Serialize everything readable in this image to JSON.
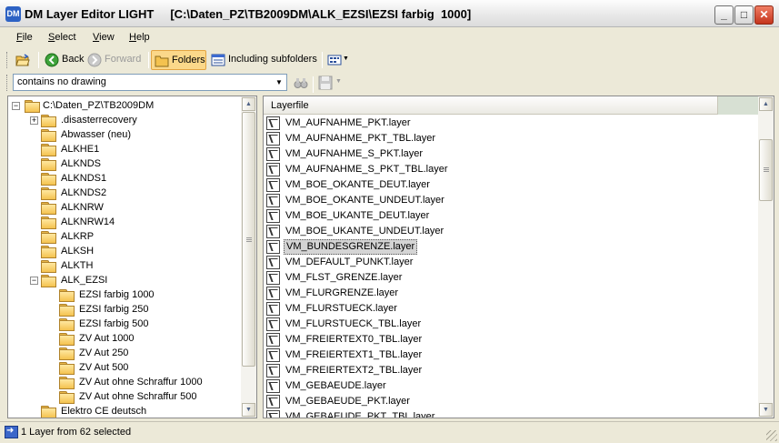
{
  "window": {
    "app_icon_text": "DM",
    "title": "DM Layer Editor LIGHT     [C:\\Daten_PZ\\TB2009DM\\ALK_EZSI\\EZSI farbig  1000]",
    "minimize": "_",
    "maximize": "□",
    "close": "✕"
  },
  "menu": [
    {
      "accel": "F",
      "rest": "ile"
    },
    {
      "accel": "S",
      "rest": "elect"
    },
    {
      "accel": "V",
      "rest": "iew"
    },
    {
      "accel": "H",
      "rest": "elp"
    }
  ],
  "toolbar": {
    "back": "Back",
    "forward": "Forward",
    "folders": "Folders",
    "including_subfolders": "Including subfolders"
  },
  "filter": {
    "value": "contains no drawing",
    "arrow": "▼"
  },
  "tree": {
    "root": "C:\\Daten_PZ\\TB2009DM",
    "items": [
      {
        "label": ".disasterrecovery",
        "level": 1,
        "expander": "+"
      },
      {
        "label": "Abwasser (neu)",
        "level": 1
      },
      {
        "label": "ALKHE1",
        "level": 1
      },
      {
        "label": "ALKNDS",
        "level": 1
      },
      {
        "label": "ALKNDS1",
        "level": 1
      },
      {
        "label": "ALKNDS2",
        "level": 1
      },
      {
        "label": "ALKNRW",
        "level": 1
      },
      {
        "label": "ALKNRW14",
        "level": 1
      },
      {
        "label": "ALKRP",
        "level": 1
      },
      {
        "label": "ALKSH",
        "level": 1
      },
      {
        "label": "ALKTH",
        "level": 1
      },
      {
        "label": "ALK_EZSI",
        "level": 1,
        "expander": "−"
      },
      {
        "label": "EZSI farbig  1000",
        "level": 2
      },
      {
        "label": "EZSI farbig  250",
        "level": 2
      },
      {
        "label": "EZSI farbig  500",
        "level": 2
      },
      {
        "label": "ZV Aut 1000",
        "level": 2
      },
      {
        "label": "ZV Aut 250",
        "level": 2
      },
      {
        "label": "ZV Aut 500",
        "level": 2
      },
      {
        "label": "ZV Aut ohne Schraffur 1000",
        "level": 2
      },
      {
        "label": "ZV Aut ohne Schraffur 500",
        "level": 2
      },
      {
        "label": "Elektro CE deutsch",
        "level": 1
      }
    ]
  },
  "list": {
    "header": "Layerfile",
    "items": [
      "VM_AUFNAHME_PKT.layer",
      "VM_AUFNAHME_PKT_TBL.layer",
      "VM_AUFNAHME_S_PKT.layer",
      "VM_AUFNAHME_S_PKT_TBL.layer",
      "VM_BOE_OKANTE_DEUT.layer",
      "VM_BOE_OKANTE_UNDEUT.layer",
      "VM_BOE_UKANTE_DEUT.layer",
      "VM_BOE_UKANTE_UNDEUT.layer",
      "VM_BUNDESGRENZE.layer",
      "VM_DEFAULT_PUNKT.layer",
      "VM_FLST_GRENZE.layer",
      "VM_FLURGRENZE.layer",
      "VM_FLURSTUECK.layer",
      "VM_FLURSTUECK_TBL.layer",
      "VM_FREIERTEXT0_TBL.layer",
      "VM_FREIERTEXT1_TBL.layer",
      "VM_FREIERTEXT2_TBL.layer",
      "VM_GEBAEUDE.layer",
      "VM_GEBAEUDE_PKT.layer",
      "VM_GEBAEUDE_PKT_TBL.layer"
    ],
    "selected_index": 8
  },
  "scroll_arrows": {
    "up": "▲",
    "down": "▼"
  },
  "status": {
    "text": "1 Layer from 62 selected"
  },
  "colors": {
    "selection": "#d4d4d4",
    "folder_active": "#fbd88a",
    "chrome": "#ece9d8"
  }
}
